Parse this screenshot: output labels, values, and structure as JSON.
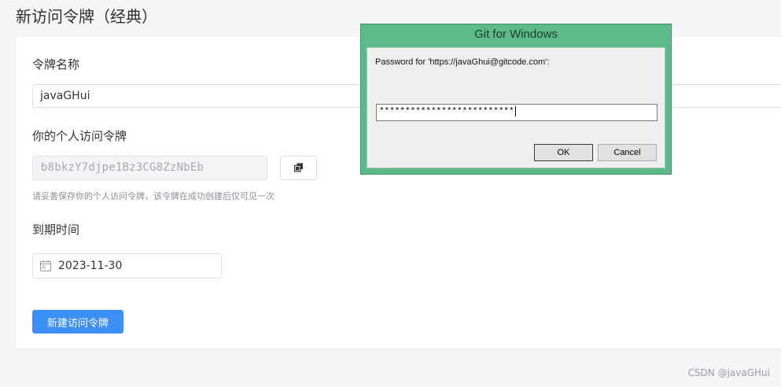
{
  "page": {
    "title": "新访问令牌（经典）"
  },
  "form": {
    "name_label": "令牌名称",
    "name_value": "javaGHui",
    "token_label": "你的个人访问令牌",
    "token_value": "b8bkzY7djpe1Bz3CG8ZzNbEb",
    "copy_icon": "copy-icon",
    "hint": "请妥善保存你的个人访问令牌，该令牌在成功创建后仅可见一次",
    "expiry_label": "到期时间",
    "expiry_value": "2023-11-30",
    "calendar_icon": "calendar-icon",
    "create_button": "新建访问令牌"
  },
  "dialog": {
    "title": "Git for Windows",
    "prompt": "Password for 'https://javaGhui@gitcode.com':",
    "password_mask": "**************************",
    "ok_label": "OK",
    "cancel_label": "Cancel"
  },
  "watermark": "CSDN @javaGHui",
  "colors": {
    "primary": "#3b8ff6",
    "dialog_frame": "#5dbb8a"
  }
}
